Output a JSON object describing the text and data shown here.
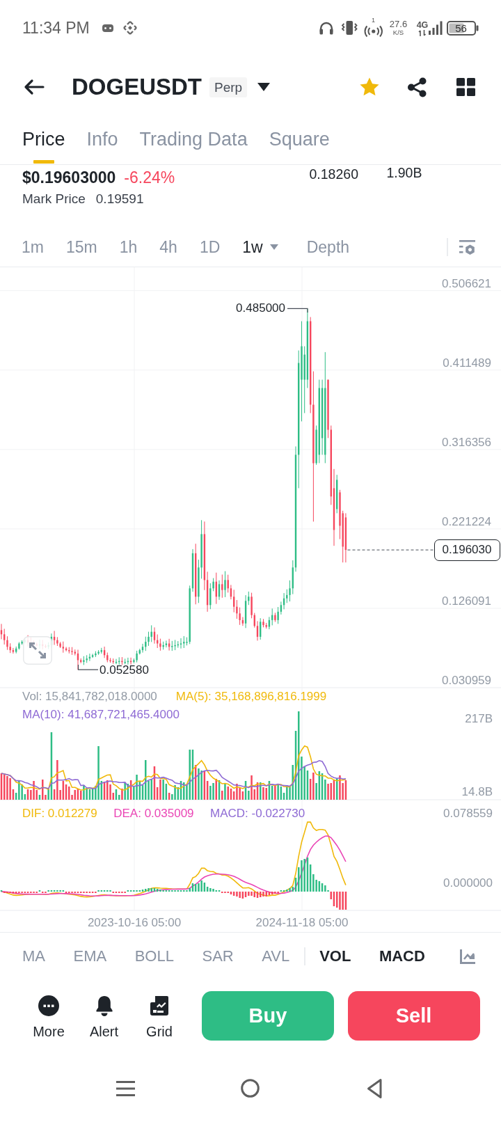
{
  "status_bar": {
    "time": "11:34 PM",
    "hotspot_count": "1",
    "speed": "27.6",
    "speed_unit": "K/S",
    "network": "4G",
    "battery": "56"
  },
  "header": {
    "symbol": "DOGEUSDT",
    "badge": "Perp"
  },
  "tabs": [
    {
      "label": "Price",
      "selected": true
    },
    {
      "label": "Info",
      "selected": false
    },
    {
      "label": "Trading Data",
      "selected": false
    },
    {
      "label": "Square",
      "selected": false
    }
  ],
  "ticker": {
    "last_price": "$0.19603000",
    "change": "-6.24%",
    "column_3": "0.18260",
    "column_4": "1.90B",
    "mark_price_label": "Mark Price",
    "mark_price": "0.19591"
  },
  "intervals": [
    {
      "label": "1m",
      "kind": "plain",
      "selected": false
    },
    {
      "label": "15m",
      "kind": "plain",
      "selected": false
    },
    {
      "label": "1h",
      "kind": "plain",
      "selected": false
    },
    {
      "label": "4h",
      "kind": "plain",
      "selected": false
    },
    {
      "label": "1D",
      "kind": "plain",
      "selected": false
    },
    {
      "label": "1w",
      "kind": "menu",
      "selected": true
    },
    {
      "label": "Depth",
      "kind": "plain",
      "selected": false
    }
  ],
  "chart": {
    "price_axis": [
      "0.506621",
      "0.411489",
      "0.316356",
      "0.221224",
      "0.126091",
      "0.030959"
    ],
    "high_marker": "0.485000",
    "low_marker": "0.052580",
    "last_price": "0.196030",
    "volume": {
      "legend": [
        {
          "text": "Vol: 15,841,782,018.0000",
          "color": "#929aa5"
        },
        {
          "text": "MA(5): 35,168,896,816.1999",
          "color": "#f0b90b"
        },
        {
          "text": "MA(10): 41,687,721,465.4000",
          "color": "#8e6ad4"
        }
      ],
      "axis": [
        "217B",
        "14.8B"
      ]
    },
    "macd": {
      "legend": [
        {
          "text": "DIF: 0.012279",
          "color": "#f0b90b"
        },
        {
          "text": "DEA: 0.035009",
          "color": "#ea45b5"
        },
        {
          "text": "MACD: -0.022730",
          "color": "#8e6ad4"
        }
      ],
      "axis": [
        "0.078559",
        "0.000000"
      ]
    },
    "time_axis": [
      "2023-10-16 05:00",
      "2024-11-18 05:00"
    ]
  },
  "indicators": {
    "main": [
      {
        "label": "MA",
        "selected": false
      },
      {
        "label": "EMA",
        "selected": false
      },
      {
        "label": "BOLL",
        "selected": false
      },
      {
        "label": "SAR",
        "selected": false
      },
      {
        "label": "AVL",
        "selected": false
      }
    ],
    "sub": [
      {
        "label": "VOL",
        "selected": true
      },
      {
        "label": "MACD",
        "selected": true
      }
    ]
  },
  "actions": [
    {
      "label": "More",
      "kind": "more"
    },
    {
      "label": "Alert",
      "kind": "alert"
    },
    {
      "label": "Grid",
      "kind": "grid"
    }
  ],
  "trade_buttons": [
    {
      "label": "Buy",
      "kind": "buy"
    },
    {
      "label": "Sell",
      "kind": "sell"
    }
  ]
}
